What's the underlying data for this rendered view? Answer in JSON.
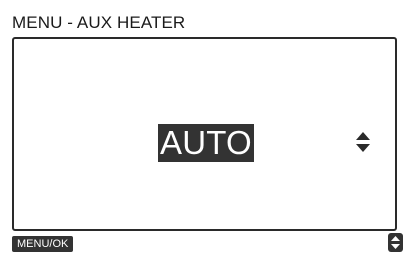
{
  "screen": {
    "title": "MENU - AUX HEATER"
  },
  "main": {
    "selected_value": "AUTO",
    "adjust_icon": "up-down-arrows-icon"
  },
  "footer": {
    "menu_ok_label": "MENU/OK",
    "navigate_icon": "up-down-arrows-icon"
  },
  "colors": {
    "highlight_background": "#333333",
    "highlight_text": "#ffffff",
    "screen_background": "#ffffff",
    "border": "#2a2a2a"
  }
}
